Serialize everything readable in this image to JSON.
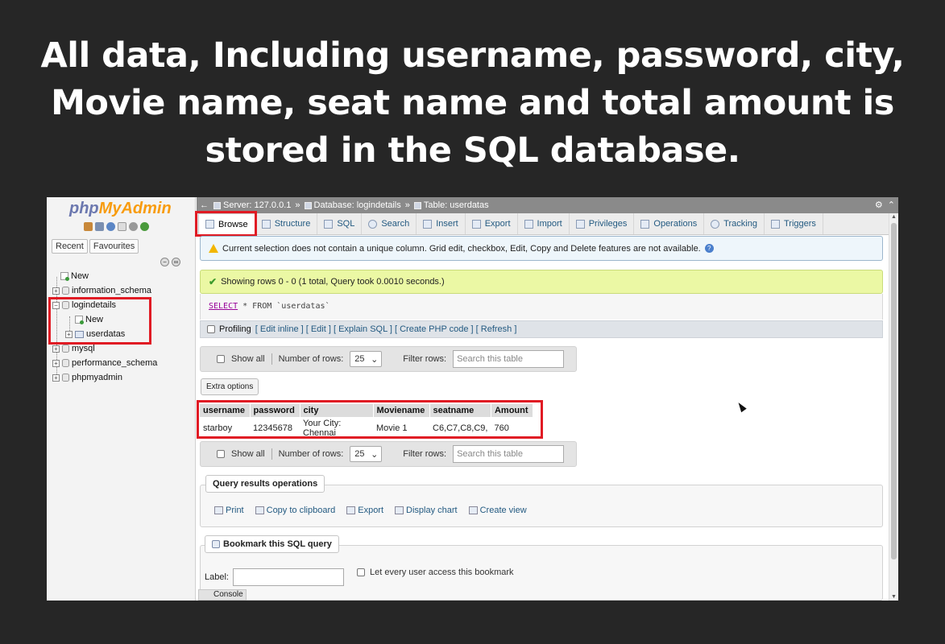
{
  "headline": {
    "line1": "All data, Including username, password, city,",
    "line2": "Movie name, seat name and total amount is",
    "line3": "stored in the SQL database."
  },
  "sidebar": {
    "logo_php": "php",
    "logo_my": "MyAdmin",
    "recent": "Recent",
    "favourites": "Favourites",
    "tree": {
      "new": "New",
      "information_schema": "information_schema",
      "logindetails": "logindetails",
      "logindetails_new": "New",
      "userdatas": "userdatas",
      "mysql": "mysql",
      "performance_schema": "performance_schema",
      "phpmyadmin": "phpmyadmin"
    }
  },
  "breadcrumb": {
    "server": "Server: 127.0.0.1",
    "database": "Database: logindetails",
    "table": "Table: userdatas"
  },
  "tabs": [
    "Browse",
    "Structure",
    "SQL",
    "Search",
    "Insert",
    "Export",
    "Import",
    "Privileges",
    "Operations",
    "Tracking",
    "Triggers"
  ],
  "notice": "Current selection does not contain a unique column. Grid edit, checkbox, Edit, Copy and Delete features are not available.",
  "success": "Showing rows 0 - 0 (1 total, Query took 0.0010 seconds.)",
  "sql": {
    "select": "SELECT",
    "rest": " * FROM `userdatas`"
  },
  "profiling": {
    "label": "Profiling",
    "links": "[ Edit inline ] [ Edit ] [ Explain SQL ] [ Create PHP code ] [ Refresh ]"
  },
  "navbar": {
    "show_all": "Show all",
    "number_of_rows": "Number of rows:",
    "rows_value": "25",
    "filter_rows": "Filter rows:",
    "search_placeholder": "Search this table"
  },
  "extra_options": "Extra options",
  "table": {
    "columns": [
      "username",
      "password",
      "city",
      "Moviename",
      "seatname",
      "Amount"
    ],
    "row": [
      "starboy",
      "12345678",
      "Your City: Chennai",
      "Movie 1",
      "C6,C7,C8,C9,",
      "760"
    ]
  },
  "query_ops": {
    "title": "Query results operations",
    "print": "Print",
    "copy": "Copy to clipboard",
    "export": "Export",
    "chart": "Display chart",
    "view": "Create view"
  },
  "bookmark": {
    "title": "Bookmark this SQL query",
    "label": "Label:",
    "checkbox": "Let every user access this bookmark"
  },
  "console": "Console",
  "colors": {
    "highlight_red": "#e01b24",
    "background": "#262626",
    "success_bg": "#ebf8a4",
    "link_blue": "#235a81"
  }
}
